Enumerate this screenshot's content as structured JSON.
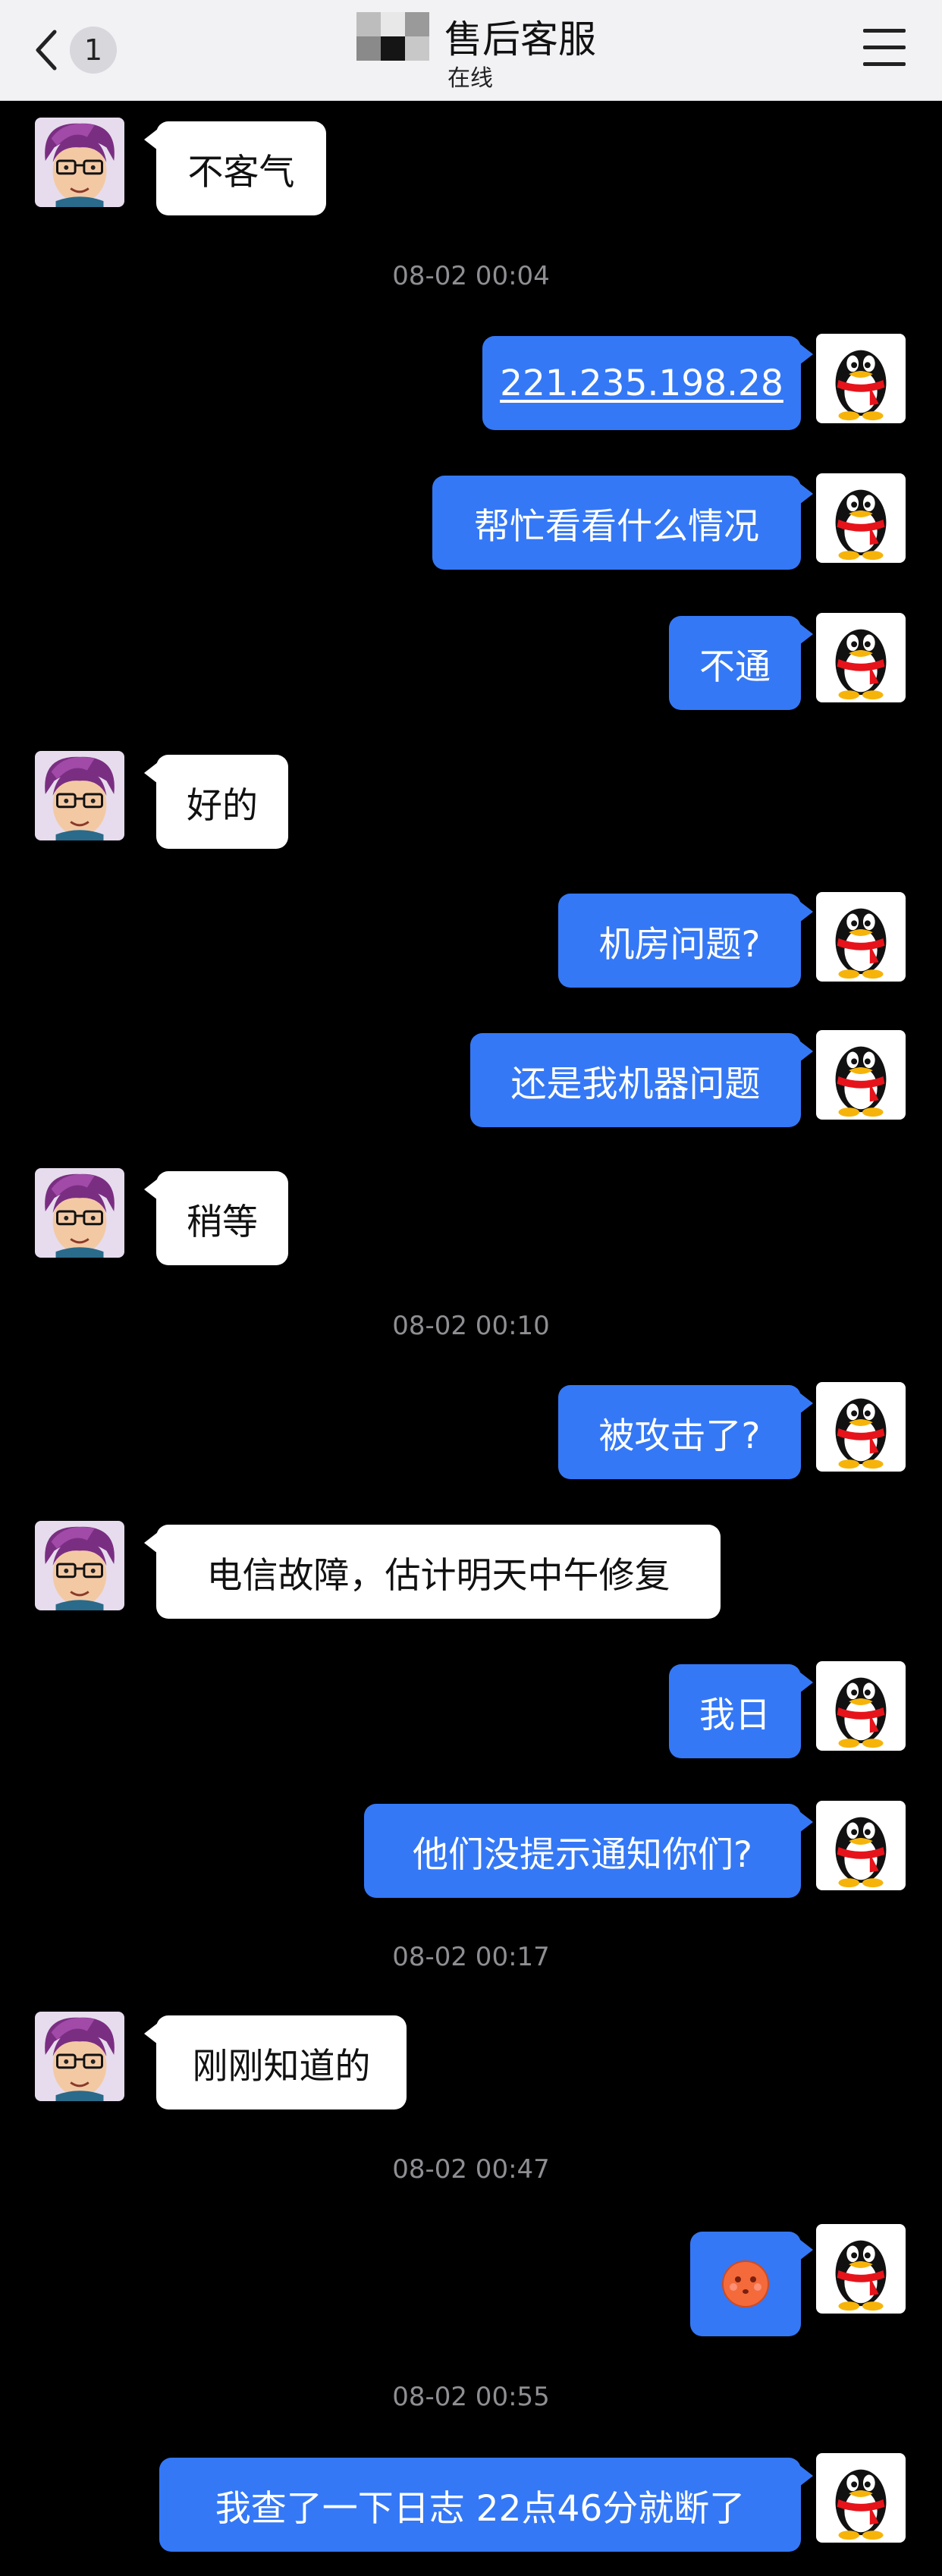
{
  "header": {
    "back_badge": "1",
    "title": "售后客服",
    "status": "在线"
  },
  "messages": {
    "m1": "不客气",
    "ts1": "08-02 00:04",
    "m2": "221.235.198.28",
    "m3": "帮忙看看什么情况",
    "m4": "不通",
    "m5": "好的",
    "m6": "机房问题?",
    "m7": "还是我机器问题",
    "m8": "稍等",
    "ts2": "08-02 00:10",
    "m9": "被攻击了?",
    "m10": "电信故障，估计明天中午修复",
    "m11": "我日",
    "m12": "他们没提示通知你们?",
    "ts3": "08-02 00:17",
    "m13": "刚刚知道的",
    "ts4": "08-02 00:47",
    "m14_emoji": "face-emoji",
    "ts5": "08-02 00:55",
    "m15": "我查了一下日志 22点46分就断了"
  },
  "colors": {
    "my_bubble": "#3478f6",
    "agent_bubble": "#ffffff",
    "background": "#000000",
    "header": "#f2f2f5",
    "timestamp": "#8e8e93"
  }
}
